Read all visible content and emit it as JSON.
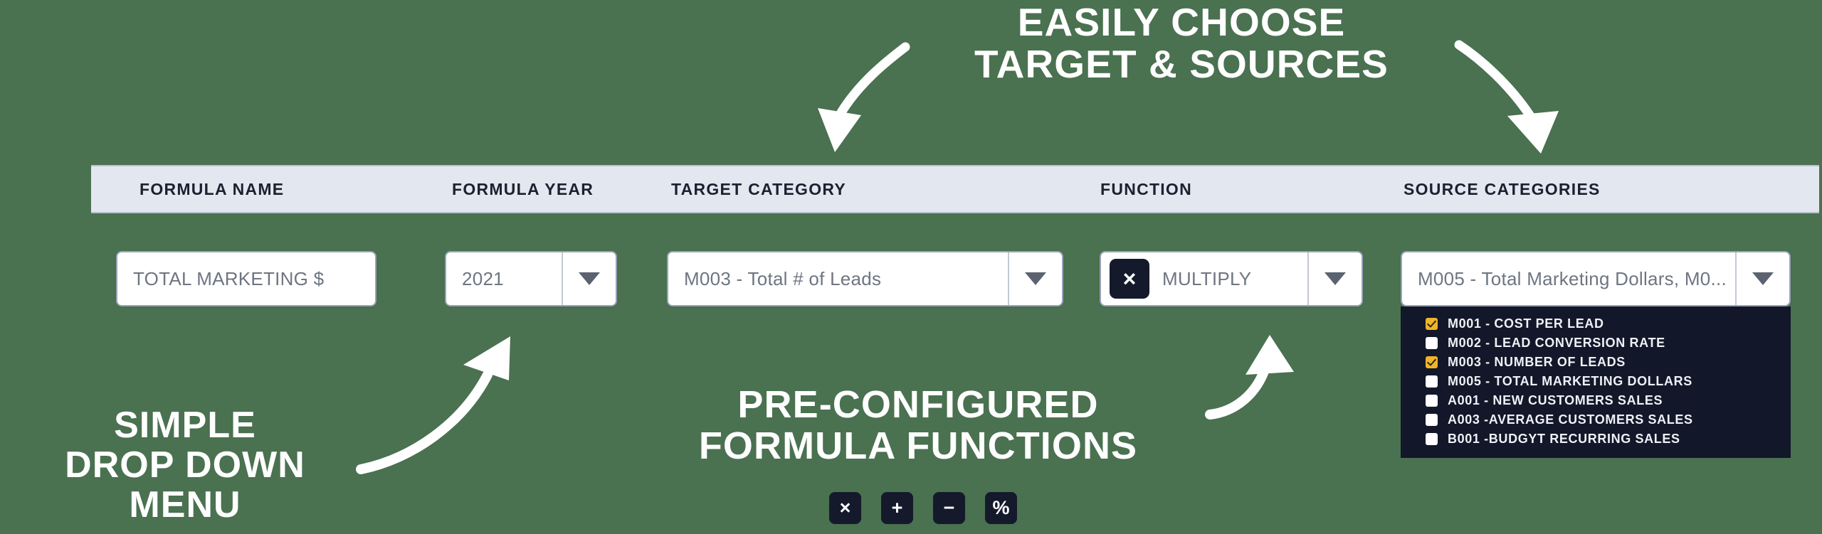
{
  "theme": {
    "background": "#4a7150",
    "header_bar_bg": "#e3e8f0",
    "header_text": "#1b2130",
    "field_border": "#9aa4b8",
    "field_text": "#6e7582",
    "dropdown_bg": "#121729",
    "checkbox_checked": "#f0b429",
    "chip_bg": "#141a2b",
    "callout_text": "#ffffff"
  },
  "callouts": {
    "top": "Easily Choose\nTarget & Sources",
    "left": "Simple\nDrop Down\nMenu",
    "middle": "Pre-Configured\nFormula Functions"
  },
  "table": {
    "columns": [
      {
        "key": "formula_name",
        "label": "FORMULA NAME"
      },
      {
        "key": "formula_year",
        "label": "FORMULA YEAR"
      },
      {
        "key": "target_category",
        "label": "TARGET CATEGORY"
      },
      {
        "key": "function",
        "label": "FUNCTION"
      },
      {
        "key": "source_categories",
        "label": "SOURCE CATEGORIES"
      }
    ]
  },
  "fields": {
    "formula_name": {
      "value": "TOTAL MARKETING $",
      "placeholder": "TOTAL MARKETING $",
      "type": "text"
    },
    "formula_year": {
      "value": "2021",
      "type": "select",
      "caret_icon": "chevron-down-icon"
    },
    "target_category": {
      "value": "M003 - Total # of Leads",
      "type": "select",
      "caret_icon": "chevron-down-icon"
    },
    "function": {
      "value": "MULTIPLY",
      "operator_glyph": "×",
      "operator_icon": "multiply-icon",
      "type": "select",
      "caret_icon": "chevron-down-icon"
    },
    "source_categories": {
      "value": "M005 - Total Marketing Dollars, M0...",
      "type": "multiselect",
      "caret_icon": "chevron-down-icon",
      "expanded": true,
      "options": [
        {
          "label": "M001 - COST PER LEAD",
          "checked": true
        },
        {
          "label": "M002 - LEAD CONVERSION RATE",
          "checked": false
        },
        {
          "label": "M003 - NUMBER OF LEADS",
          "checked": true
        },
        {
          "label": "M005 - TOTAL MARKETING DOLLARS",
          "checked": false
        },
        {
          "label": "A001 - NEW CUSTOMERS SALES",
          "checked": false
        },
        {
          "label": "A003 -AVERAGE CUSTOMERS SALES",
          "checked": false
        },
        {
          "label": "B001 -BUDGYT RECURRING SALES",
          "checked": false
        }
      ]
    }
  },
  "operator_buttons": [
    {
      "name": "multiply-button",
      "glyph": "×",
      "icon": "multiply-icon"
    },
    {
      "name": "add-button",
      "glyph": "+",
      "icon": "plus-icon"
    },
    {
      "name": "subtract-button",
      "glyph": "−",
      "icon": "minus-icon"
    },
    {
      "name": "percent-button",
      "glyph": "%",
      "icon": "percent-icon"
    }
  ]
}
